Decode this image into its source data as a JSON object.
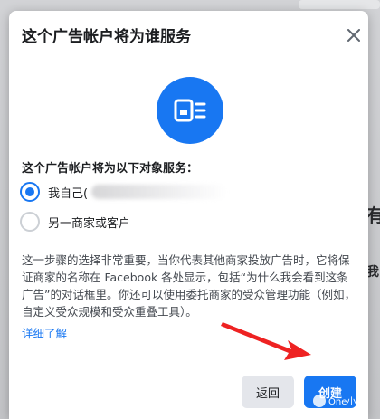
{
  "background": {
    "side_char_1": "有",
    "side_char_2": "我"
  },
  "dialog": {
    "title": "这个广告帐户将为谁服务",
    "close_icon": "close-icon",
    "illustration_icon": "ad-account-icon",
    "section_label": "这个广告帐户将为以下对象服务：",
    "options": [
      {
        "label": "我自己(",
        "checked": true
      },
      {
        "label": "另一商家或客户",
        "checked": false
      }
    ],
    "description": "这一步骤的选择非常重要，当你代表其他商家投放广告时，它将保证商家的名称在 Facebook 各处显示，包括“为什么我会看到这条广告”的对话框里。你还可以使用委托商家的受众管理功能（例如，自定义受众规模和受众重叠工具）。",
    "learn_more": "详细了解",
    "back_label": "返回",
    "create_label": "创建",
    "accent_color": "#1877f2"
  },
  "watermark": {
    "text": "One小白"
  }
}
